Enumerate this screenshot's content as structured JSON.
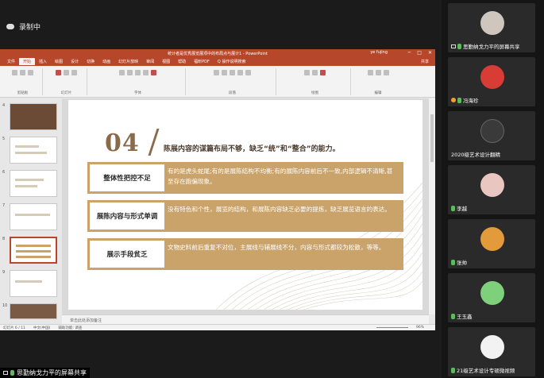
{
  "recording": {
    "label": "录制中"
  },
  "ppt": {
    "title": "统计者是优秀展览展项中的布局点与展计1 - PowerPoint",
    "user": "ye fujing",
    "tabs": [
      "文件",
      "开始",
      "插入",
      "绘图",
      "设计",
      "切换",
      "动画",
      "幻灯片放映",
      "审阅",
      "视图",
      "帮助",
      "福昕PDF",
      "Q 操作说明搜索"
    ],
    "share": "共享",
    "ribbon_groups": [
      "剪贴板",
      "幻灯片",
      "字体",
      "段落",
      "绘图",
      "编辑"
    ],
    "notes_placeholder": "单击此处添加备注",
    "status": {
      "slide": "幻灯片 6 / 11",
      "lang": "中文(中国)",
      "accessibility": "辅助功能: 调查",
      "zoom": "96%"
    },
    "thumbnails": [
      {
        "num": "4"
      },
      {
        "num": "5"
      },
      {
        "num": "6"
      },
      {
        "num": "7"
      },
      {
        "num": "8"
      },
      {
        "num": "9"
      },
      {
        "num": "10"
      }
    ]
  },
  "slide": {
    "number": "04",
    "headline": "陈展内容的谋篇布局不够，缺乏“统”和“整合”的能力。",
    "rows": [
      {
        "label": "整体性把控不足",
        "text": "有的是虎头蛇尾;有的是展陈结构不均衡;有的展陈内容前后不一致,内部逻辑不清晰,甚至存在跑偏现象。"
      },
      {
        "label": "展陈内容与形式单调",
        "text": "没有特色和个性，展览的结构，和展陈内容缺乏必要的提炼，缺乏展览语言的表达。"
      },
      {
        "label": "展示手段贫乏",
        "text": "文物史料前后重复不对位，主展线与辅展线不分，内容与形式都较为松散，等等。"
      }
    ]
  },
  "participants": [
    {
      "name": "思勤纳戈力平的屏幕共享",
      "avatar_color": "#cfc7be"
    },
    {
      "name": "冯海珍",
      "avatar_color": "#d93b35"
    },
    {
      "name": "2020级艺术设计翻精",
      "avatar_color": "#3a3a3a"
    },
    {
      "name": "李越",
      "avatar_color": "#e9c6c0"
    },
    {
      "name": "张帅",
      "avatar_color": "#e29a3b"
    },
    {
      "name": "王玉鑫",
      "avatar_color": "#7fd07a"
    },
    {
      "name": "21级艺术设计专硕微视频",
      "avatar_color": "#f2f2f2"
    }
  ],
  "bottom_label": "思勤纳戈力平的屏幕共享"
}
